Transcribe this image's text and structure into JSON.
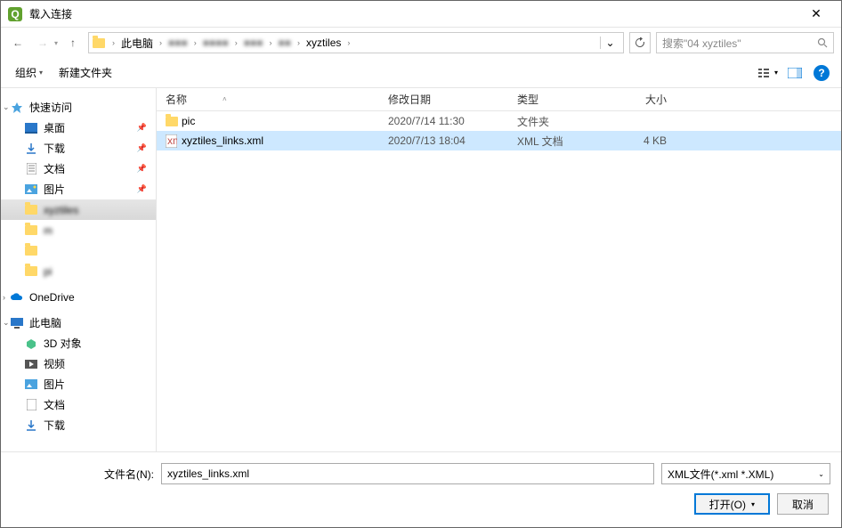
{
  "title": "载入连接",
  "breadcrumb": {
    "pc": "此电脑",
    "last": "xyztiles"
  },
  "search_placeholder": "搜索\"04 xyztiles\"",
  "toolbar": {
    "organize": "组织",
    "new_folder": "新建文件夹"
  },
  "sidebar": {
    "quick": "快速访问",
    "desktop": "桌面",
    "downloads": "下载",
    "documents": "文档",
    "pictures": "图片",
    "f1": "xyztiles",
    "f2": "m",
    "f3": " ",
    "f4": "pi",
    "onedrive": "OneDrive",
    "thispc": "此电脑",
    "obj3d": "3D 对象",
    "videos": "视频",
    "pics2": "图片",
    "docs2": "文档",
    "dl2": "下载"
  },
  "columns": {
    "name": "名称",
    "date": "修改日期",
    "type": "类型",
    "size": "大小"
  },
  "rows": [
    {
      "name": "pic",
      "date": "2020/7/14 11:30",
      "type": "文件夹",
      "size": "",
      "kind": "folder"
    },
    {
      "name": "xyztiles_links.xml",
      "date": "2020/7/13 18:04",
      "type": "XML 文档",
      "size": "4 KB",
      "kind": "xml",
      "selected": true
    }
  ],
  "footer": {
    "filename_label": "文件名(N):",
    "filename_value": "xyztiles_links.xml",
    "filter": "XML文件(*.xml *.XML)",
    "open": "打开(O)",
    "cancel": "取消"
  }
}
